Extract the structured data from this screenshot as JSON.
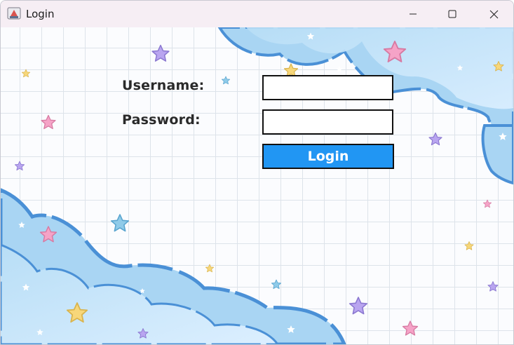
{
  "window": {
    "title": "Login",
    "controls": [
      "minimize",
      "maximize",
      "close"
    ]
  },
  "form": {
    "username_label": "Username:",
    "username_value": "",
    "password_label": "Password:",
    "password_value": "",
    "login_button": "Login"
  },
  "colors": {
    "titlebar": "#f6eef4",
    "grid": "#dde3ea",
    "cloud": "#9ed0f1",
    "cloud_outline": "#4a90d6",
    "login_button": "#2196f3"
  },
  "background": {
    "theme": "pastel-grid-clouds-stars",
    "star_colors": [
      "#f5a3c7",
      "#b9a5f0",
      "#f7d77a",
      "#8fcbe9"
    ]
  }
}
